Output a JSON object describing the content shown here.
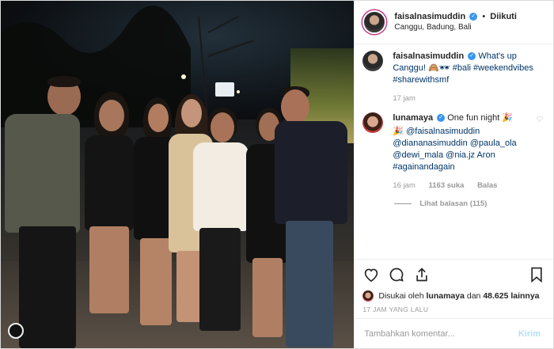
{
  "header": {
    "username": "faisalnasimuddin",
    "separator": "•",
    "follow_status": "Diikuti",
    "location": "Canggu, Badung, Bali"
  },
  "caption": {
    "username": "faisalnasimuddin",
    "text": "What's up Canggu! 🙈🕶 #bali #weekendvibes #sharewithsmf",
    "age": "17 jam"
  },
  "comment": {
    "username": "lunamaya",
    "text": "One fun night 🎉",
    "mentions": "🎉 @faisalnasimuddin @diananasimuddin @paula_ola @dewi_mala @nia.jz Aron #againandagain",
    "age": "16 jam",
    "likes": "1163 suka",
    "reply": "Balas",
    "view_replies": "Lihat balasan (115)"
  },
  "likes": {
    "prefix": "Disukai oleh",
    "user": "lunamaya",
    "middle": "dan",
    "count": "48.625 lainnya"
  },
  "timestamp": "17 JAM YANG LALU",
  "composer": {
    "placeholder": "Tambahkan komentar...",
    "post_label": "Kirim"
  },
  "colors": {
    "verified": "#3897f0",
    "link": "#003569",
    "muted": "#999999"
  }
}
